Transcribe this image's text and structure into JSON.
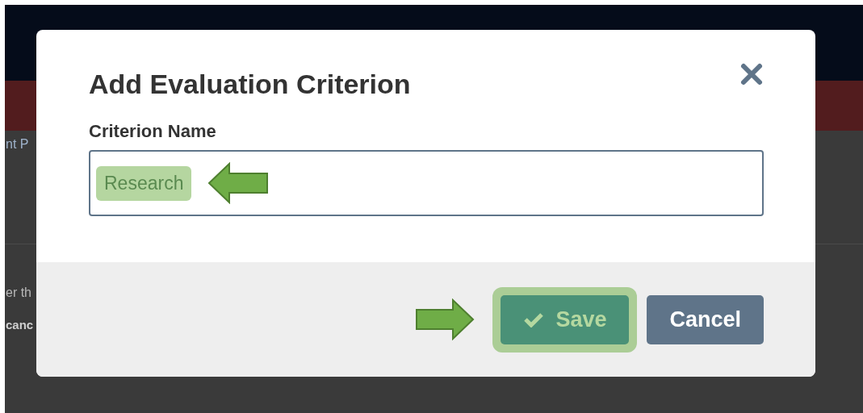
{
  "background_page": {
    "texts": [
      {
        "text": "nt P",
        "kind": "link"
      },
      {
        "text": "er th",
        "kind": "body"
      },
      {
        "text": "canc",
        "kind": "bold"
      }
    ]
  },
  "dialog": {
    "title": "Add Evaluation Criterion",
    "field": {
      "label": "Criterion Name",
      "value": "Research",
      "highlighted": true
    },
    "buttons": [
      {
        "label": "Save",
        "kind": "primary",
        "highlighted": true
      },
      {
        "label": "Cancel",
        "kind": "secondary",
        "highlighted": false
      }
    ]
  }
}
